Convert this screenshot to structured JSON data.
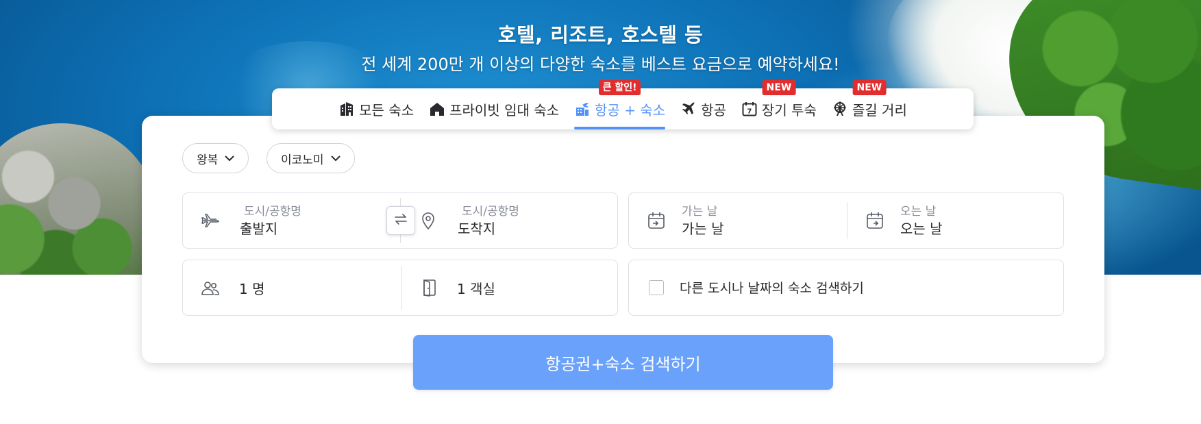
{
  "hero": {
    "title": "호텔, 리조트, 호스텔 등",
    "subtitle": "전 세계 200만 개 이상의 다양한 숙소를 베스트 요금으로 예약하세요!"
  },
  "tabs": [
    {
      "label": "모든 숙소",
      "icon": "hotel-building-icon",
      "badge": null,
      "active": false
    },
    {
      "label": "프라이빗 임대 숙소",
      "icon": "house-icon",
      "badge": null,
      "active": false
    },
    {
      "label": "항공 + 숙소",
      "icon": "flight-hotel-icon",
      "badge": "큰 할인!",
      "active": true
    },
    {
      "label": "항공",
      "icon": "airplane-icon",
      "badge": null,
      "active": false
    },
    {
      "label": "장기 투숙",
      "icon": "calendar-7-icon",
      "badge": "NEW",
      "active": false
    },
    {
      "label": "즐길 거리",
      "icon": "ferris-wheel-icon",
      "badge": "NEW",
      "active": false
    }
  ],
  "trip_options": {
    "trip_type": "왕복",
    "cabin_class": "이코노미"
  },
  "origin": {
    "label": "도시/공항명",
    "value": "출발지"
  },
  "destination": {
    "label": "도시/공항명",
    "value": "도착지"
  },
  "depart": {
    "label": "가는 날",
    "value": "가는 날"
  },
  "return": {
    "label": "오는 날",
    "value": "오는 날"
  },
  "travelers": {
    "value": "1 명"
  },
  "rooms": {
    "value": "1 객실"
  },
  "other_city_option": {
    "label": "다른 도시나 날짜의 숙소 검색하기",
    "checked": false
  },
  "search_button": {
    "label": "항공권+숙소 검색하기"
  },
  "colors": {
    "accent": "#5392f9",
    "search_button": "#6aa1fb",
    "badge_red": "#e12d2d"
  }
}
